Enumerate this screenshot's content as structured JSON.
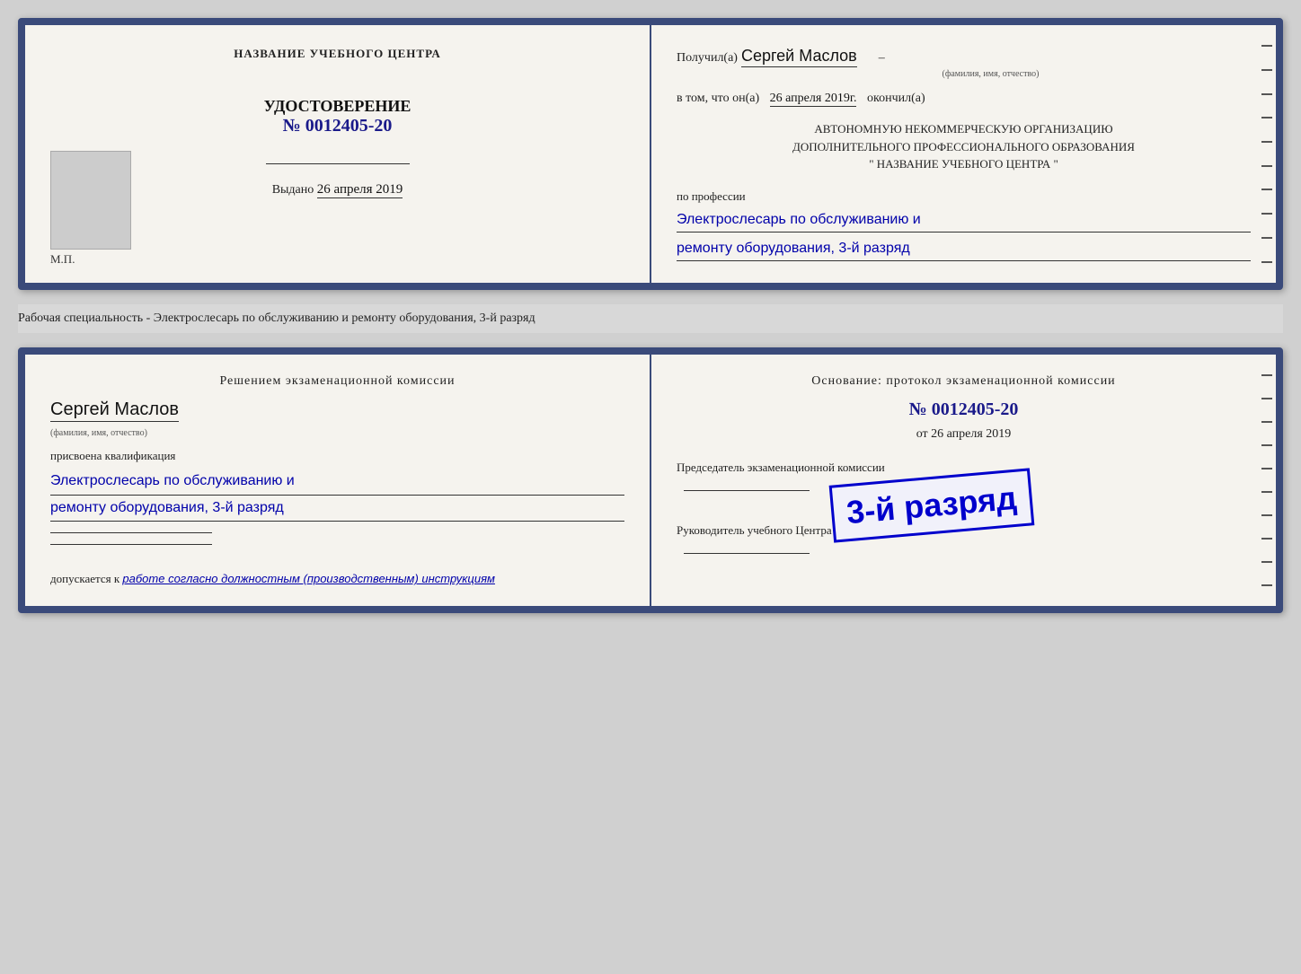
{
  "doc1": {
    "left": {
      "training_center_label": "НАЗВАНИЕ УЧЕБНОГО ЦЕНТРА",
      "udostoverenie_title": "УДОСТОВЕРЕНИЕ",
      "doc_number": "№ 0012405-20",
      "issued_label": "Выдано",
      "issued_date": "26 апреля 2019",
      "mp_label": "М.П."
    },
    "right": {
      "poluchil_label": "Получил(а)",
      "poluchil_name": "Сергей Маслов",
      "fio_subtitle": "(фамилия, имя, отчество)",
      "dash": "–",
      "v_tom_label": "в том, что он(а)",
      "v_tom_date": "26 апреля 2019г.",
      "okonchil_label": "окончил(а)",
      "org_line1": "АВТОНОМНУЮ НЕКОММЕРЧЕСКУЮ ОРГАНИЗАЦИЮ",
      "org_line2": "ДОПОЛНИТЕЛЬНОГО ПРОФЕССИОНАЛЬНОГО ОБРАЗОВАНИЯ",
      "org_line3": "\"  НАЗВАНИЕ УЧЕБНОГО ЦЕНТРА  \"",
      "po_professii_label": "по профессии",
      "profession_line1": "Электрослесарь по обслуживанию и",
      "profession_line2": "ремонту оборудования, 3-й разряд"
    }
  },
  "separator": {
    "text": "Рабочая специальность - Электрослесарь по обслуживанию и ремонту оборудования, 3-й разряд"
  },
  "doc2": {
    "left": {
      "resheniem_title": "Решением экзаменационной комиссии",
      "person_name": "Сергей Маслов",
      "fio_subtitle": "(фамилия, имя, отчество)",
      "prisvoena_label": "присвоена квалификация",
      "qualification_line1": "Электрослесарь по обслуживанию и",
      "qualification_line2": "ремонту оборудования, 3-й разряд",
      "dopuskaetsya_label": "допускается к",
      "dopusk_text": "работе согласно должностным (производственным) инструкциям"
    },
    "right": {
      "osnovanie_title": "Основание: протокол экзаменационной комиссии",
      "protocol_number": "№  0012405-20",
      "ot_label": "от",
      "ot_date": "26 апреля 2019",
      "predsedatel_title": "Председатель экзаменационной комиссии",
      "rukovoditel_title": "Руководитель учебного Центра",
      "stamp_text": "3-й разряд"
    }
  }
}
